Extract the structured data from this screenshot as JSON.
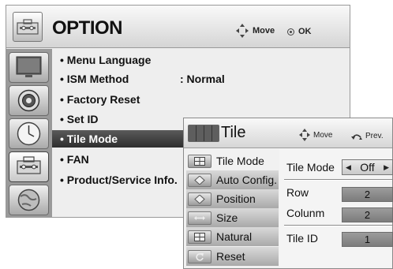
{
  "option_menu": {
    "title": "OPTION",
    "move_hint": "Move",
    "ok_hint": "OK",
    "sidebar_icons": [
      "monitor-icon",
      "speaker-icon",
      "clock-icon",
      "option-icon",
      "globe-icon"
    ],
    "items": [
      {
        "label": "• Menu Language",
        "value": ""
      },
      {
        "label": "• ISM Method",
        "value": ": Normal"
      },
      {
        "label": "• Factory Reset",
        "value": ""
      },
      {
        "label": "• Set ID",
        "value": ""
      },
      {
        "label": "• Tile Mode",
        "value": ""
      },
      {
        "label": "• FAN",
        "value": ""
      },
      {
        "label": "• Product/Service Info.",
        "value": ""
      }
    ],
    "selected_index": 4
  },
  "tile_menu": {
    "title": "Tile",
    "move_hint": "Move",
    "prev_hint": "Prev.",
    "items": [
      {
        "label": "Tile Mode",
        "icon": "tile-grid-icon"
      },
      {
        "label": "Auto Config.",
        "icon": "auto-config-icon"
      },
      {
        "label": "Position",
        "icon": "position-icon"
      },
      {
        "label": "Size",
        "icon": "size-icon"
      },
      {
        "label": "Natural",
        "icon": "natural-icon"
      },
      {
        "label": "Reset",
        "icon": "reset-icon"
      }
    ],
    "settings": {
      "tile_mode_label": "Tile Mode",
      "tile_mode_value": "Off",
      "row_label": "Row",
      "row_value": "2",
      "column_label": "Colunm",
      "column_value": "2",
      "tile_id_label": "Tile ID",
      "tile_id_value": "1"
    }
  },
  "colors": {
    "selected_item_bg": "#3a3a3a",
    "value_box_bg": "#8c8c8c",
    "sidebar_bg": "#9a9a9a"
  }
}
